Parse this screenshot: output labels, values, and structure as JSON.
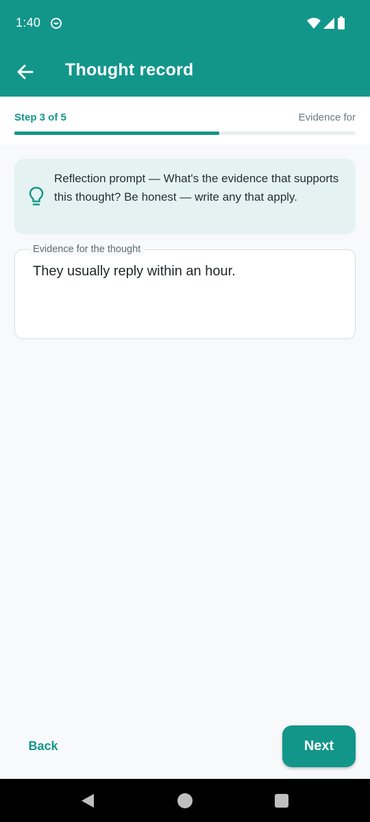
{
  "status_bar": {
    "time": "1:40",
    "app_icon": "smiley-circle-icon",
    "wifi_icon": "wifi-icon",
    "signal_icon": "signal-icon",
    "battery_icon": "battery-icon"
  },
  "app_bar": {
    "back_icon": "back-arrow-icon",
    "title": "Thought record"
  },
  "stepper": {
    "step_label": "Step 3 of 5",
    "step_name": "Evidence for",
    "progress_fraction": 0.6
  },
  "prompt": {
    "icon": "lightbulb-icon",
    "text": "Reflection prompt — What's the evidence that supports this thought? Be honest — write any that apply."
  },
  "evidence_field": {
    "label": "Evidence for the thought",
    "value": "They usually reply within an hour."
  },
  "actions": {
    "back_label": "Back",
    "next_label": "Next"
  },
  "system_nav": {
    "back_icon": "nav-back-icon",
    "home_icon": "nav-home-icon",
    "recents_icon": "nav-recents-icon"
  },
  "colors": {
    "primary": "#13968a",
    "background": "#f7f9fb",
    "prompt_background": "#e5f2f2",
    "progress_track": "#e8eef2"
  }
}
